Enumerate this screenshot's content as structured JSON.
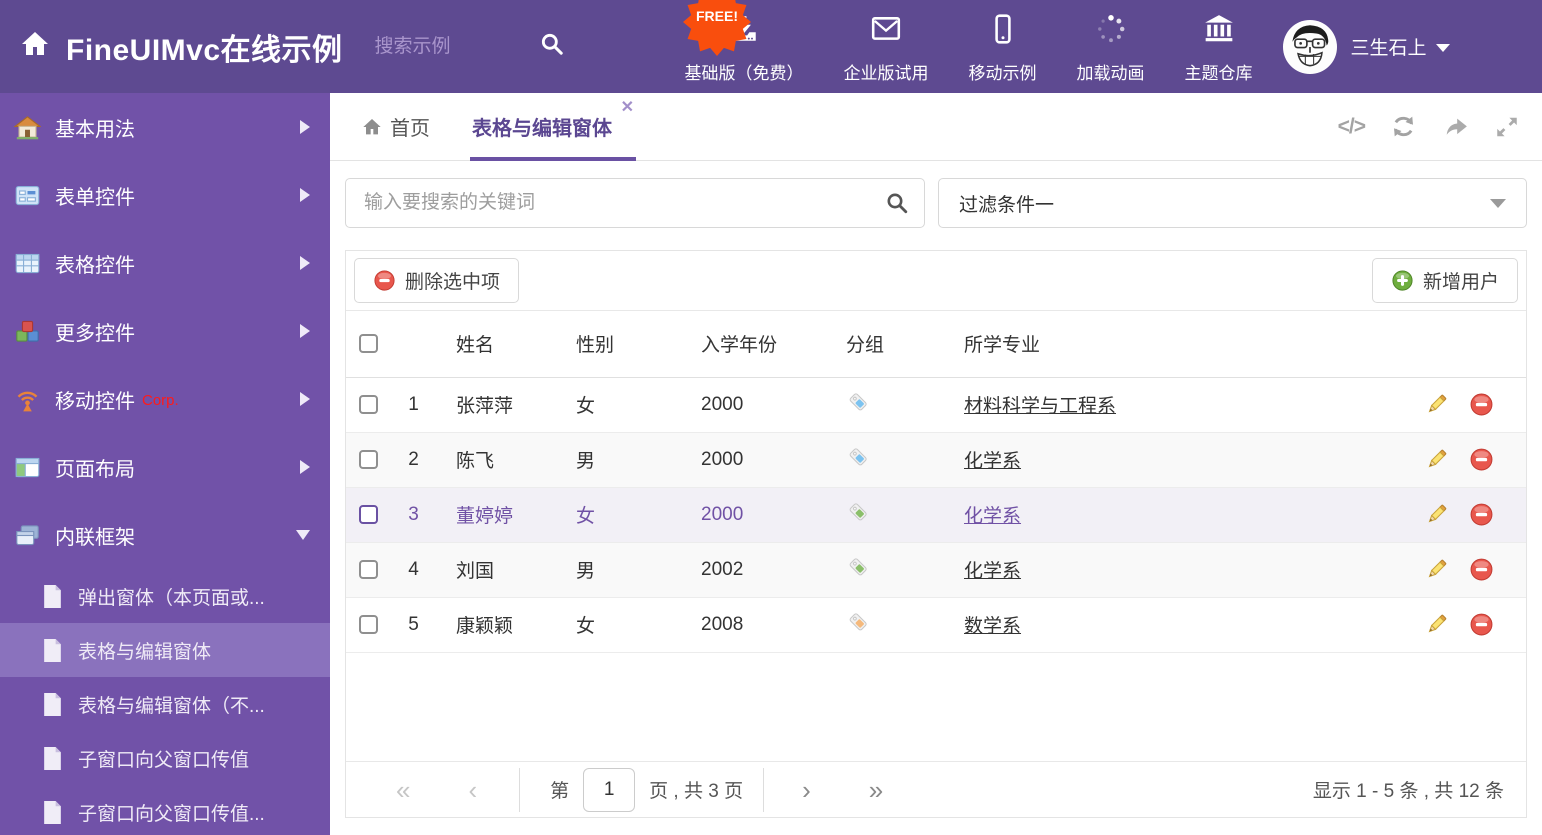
{
  "header": {
    "title": "FineUIMvc在线示例",
    "search_placeholder": "搜索示例",
    "free_badge": "FREE!",
    "nav": [
      {
        "icon": "download",
        "label": "基础版（免费）"
      },
      {
        "icon": "envelope",
        "label": "企业版试用"
      },
      {
        "icon": "mobile",
        "label": "移动示例"
      },
      {
        "icon": "spinner",
        "label": "加载动画"
      },
      {
        "icon": "bank",
        "label": "主题仓库"
      }
    ],
    "user": "三生石上"
  },
  "sidebar": {
    "items": [
      {
        "icon": "house",
        "label": "基本用法",
        "expanded": false
      },
      {
        "icon": "form",
        "label": "表单控件",
        "expanded": false
      },
      {
        "icon": "table",
        "label": "表格控件",
        "expanded": false
      },
      {
        "icon": "cubes",
        "label": "更多控件",
        "expanded": false
      },
      {
        "icon": "antenna",
        "label": "移动控件",
        "badge": "Corp.",
        "expanded": false
      },
      {
        "icon": "layout",
        "label": "页面布局",
        "expanded": false
      },
      {
        "icon": "frames",
        "label": "内联框架",
        "expanded": true
      }
    ],
    "subitems": [
      {
        "label": "弹出窗体（本页面或...",
        "selected": false
      },
      {
        "label": "表格与编辑窗体",
        "selected": true
      },
      {
        "label": "表格与编辑窗体（不...",
        "selected": false
      },
      {
        "label": "子窗口向父窗口传值",
        "selected": false
      },
      {
        "label": "子窗口向父窗口传值...",
        "selected": false
      }
    ]
  },
  "tabs": {
    "home_label": "首页",
    "active_label": "表格与编辑窗体",
    "close_glyph": "✕"
  },
  "filters": {
    "search_placeholder": "输入要搜索的关键词",
    "filter_value": "过滤条件一"
  },
  "toolbar": {
    "delete_label": "删除选中项",
    "add_label": "新增用户"
  },
  "table": {
    "columns": [
      "姓名",
      "性别",
      "入学年份",
      "分组",
      "所学专业"
    ],
    "rows": [
      {
        "num": "1",
        "name": "张萍萍",
        "gender": "女",
        "year": "2000",
        "tag_color": "#7cc3f0",
        "major": "材料科学与工程系",
        "selected": false
      },
      {
        "num": "2",
        "name": "陈飞",
        "gender": "男",
        "year": "2000",
        "tag_color": "#7cc3f0",
        "major": "化学系",
        "selected": false
      },
      {
        "num": "3",
        "name": "董婷婷",
        "gender": "女",
        "year": "2000",
        "tag_color": "#8bbf6a",
        "major": "化学系",
        "selected": true
      },
      {
        "num": "4",
        "name": "刘国",
        "gender": "男",
        "year": "2002",
        "tag_color": "#8bbf6a",
        "major": "化学系",
        "selected": false
      },
      {
        "num": "5",
        "name": "康颖颖",
        "gender": "女",
        "year": "2008",
        "tag_color": "#f5b97c",
        "major": "数学系",
        "selected": false
      }
    ]
  },
  "pagination": {
    "page_prefix": "第",
    "current_page": "1",
    "page_suffix": "页 , 共 3 页",
    "summary": "显示 1 - 5 条 , 共 12 条"
  },
  "colors": {
    "header_bg": "#5e4a91",
    "sidebar_bg": "#7152a8",
    "sidebar_selected": "#8a72bd",
    "accent": "#6a51a3",
    "free_badge": "#f94e0d",
    "delete_icon": "#e8574d",
    "add_icon": "#6fae3e"
  }
}
